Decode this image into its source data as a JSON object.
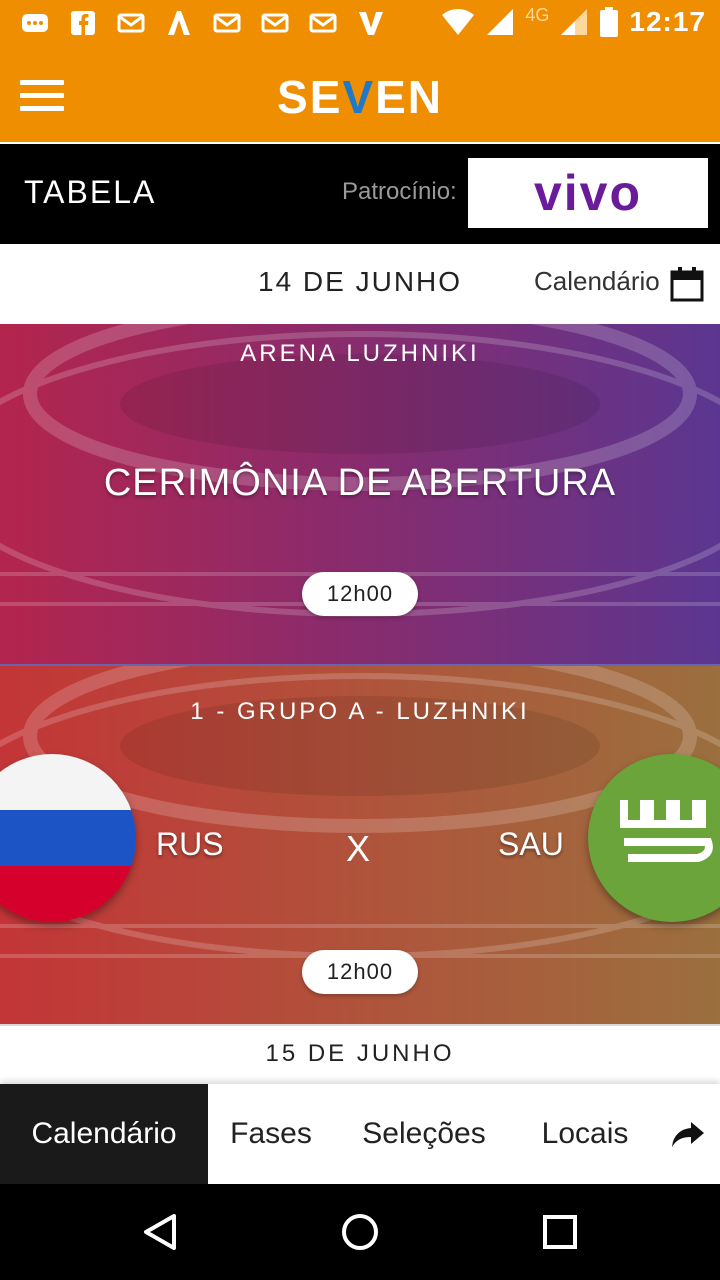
{
  "status_bar": {
    "time": "12:17",
    "network": "4G",
    "left_icons": [
      "chat-icon",
      "facebook-icon",
      "mail-icon",
      "arrow-app-icon",
      "mail-icon",
      "mail-icon",
      "mail-icon",
      "v-app-icon"
    ]
  },
  "app_bar": {
    "brand": "SEVEN"
  },
  "header": {
    "title": "TABELA",
    "sponsor_label": "Patrocínio:",
    "sponsor_name": "vivo"
  },
  "date_header": {
    "date": "14 DE JUNHO",
    "calendar_link": "Calendário"
  },
  "events": [
    {
      "venue": "ARENA LUZHNIKI",
      "title": "CERIMÔNIA DE ABERTURA",
      "time": "12h00"
    },
    {
      "venue": "1 - GRUPO A - LUZHNIKI",
      "home": "RUS",
      "separator": "X",
      "away": "SAU",
      "time": "12h00"
    }
  ],
  "next_date": "15 DE JUNHO",
  "tabs": [
    {
      "label": "Calendário",
      "active": true
    },
    {
      "label": "Fases"
    },
    {
      "label": "Seleções"
    },
    {
      "label": "Locais"
    }
  ],
  "colors": {
    "brand_orange": "#ef8e00",
    "vivo_purple": "#6a1b9a",
    "rus_white": "#f4f4f4",
    "rus_blue": "#1c53c5",
    "rus_red": "#d6002c",
    "sau_green": "#6aa43a"
  }
}
